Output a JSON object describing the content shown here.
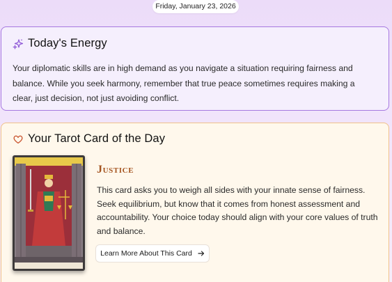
{
  "date": "Friday, January 23, 2026",
  "energy": {
    "title": "Today's Energy",
    "icon": "sparkle-icon",
    "text": "Your diplomatic skills are in high demand as you navigate a situation requiring fairness and balance. While you seek harmony, remember that true peace sometimes requires making a clear, just decision, not just avoiding conflict."
  },
  "tarot": {
    "title": "Your Tarot Card of the Day",
    "icon": "heart-icon",
    "card_name": "Justice",
    "card_image_label": "JUSTICE",
    "text": "This card asks you to weigh all sides with your innate sense of fairness. Seek equilibrium, but know that it comes from honest assessment and accountability. Your choice today should align with your core values of truth and balance.",
    "button_label": "Learn More About This Card",
    "button_icon": "arrow-right-icon"
  },
  "colors": {
    "energy_border": "#a678e0",
    "tarot_border": "#f0c089",
    "card_name": "#a4531f"
  }
}
